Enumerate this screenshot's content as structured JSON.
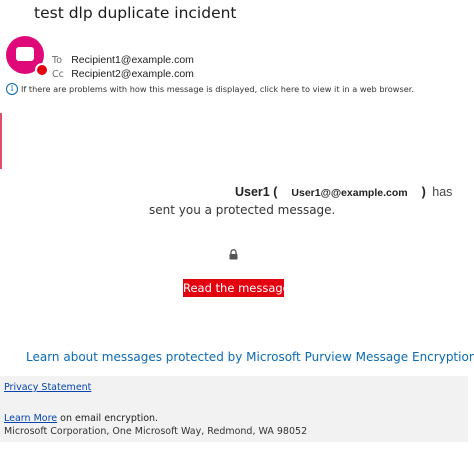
{
  "email": {
    "subject": "test dlp duplicate incident",
    "to_label": "To",
    "to_value": "Recipient1@example.com",
    "cc_label": "Cc",
    "cc_value": "Recipient2@example.com",
    "info_text": "If there are problems with how this message is displayed, click here to view it in a web browser."
  },
  "body": {
    "sender_name": "User1 (",
    "sender_email": "User1@@example.com",
    "sender_close": ")",
    "has_text": "has",
    "sent_text": "sent you a protected message.",
    "read_button": "Read the message",
    "learn_link": "Learn about messages protected by Microsoft Purview Message Encryption."
  },
  "footer": {
    "privacy": "Privacy Statement",
    "learn_more": "Learn More",
    "learn_more_suffix": " on email encryption.",
    "address": "Microsoft Corporation, One Microsoft Way, Redmond, WA 98052"
  },
  "colors": {
    "accent_red": "#e3000f",
    "avatar_pink": "#e0097a",
    "link_blue": "#0b6bb3"
  },
  "icons": {
    "avatar": "app-avatar-icon",
    "info": "info-icon",
    "lock": "lock-icon"
  }
}
